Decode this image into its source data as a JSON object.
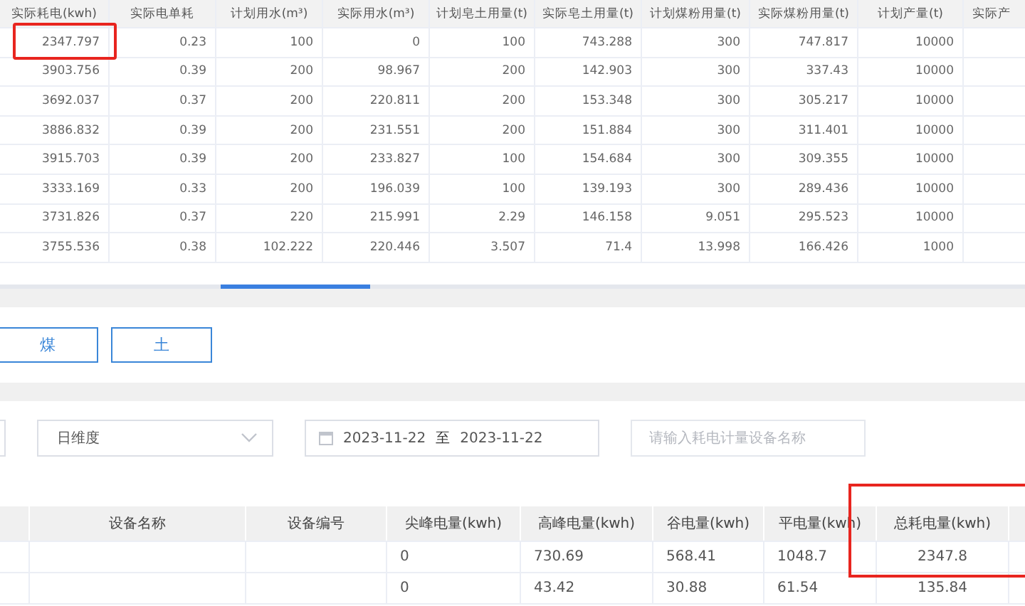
{
  "top_table": {
    "columns": [
      {
        "label": "实际耗电(kwh)"
      },
      {
        "label": "实际电单耗"
      },
      {
        "label": "计划用水(m³)"
      },
      {
        "label": "实际用水(m³)"
      },
      {
        "label": "计划皂土用量(t)"
      },
      {
        "label": "实际皂土用量(t)"
      },
      {
        "label": "计划煤粉用量(t)"
      },
      {
        "label": "实际煤粉用量(t)"
      },
      {
        "label": "计划产量(t)"
      },
      {
        "label": "实际产"
      }
    ],
    "rows": [
      [
        "2347.797",
        "0.23",
        "100",
        "0",
        "100",
        "743.288",
        "300",
        "747.817",
        "10000",
        ""
      ],
      [
        "3903.756",
        "0.39",
        "200",
        "98.967",
        "200",
        "142.903",
        "300",
        "337.43",
        "10000",
        ""
      ],
      [
        "3692.037",
        "0.37",
        "200",
        "220.811",
        "200",
        "153.348",
        "300",
        "305.217",
        "10000",
        ""
      ],
      [
        "3886.832",
        "0.39",
        "200",
        "231.551",
        "200",
        "151.884",
        "300",
        "311.401",
        "10000",
        ""
      ],
      [
        "3915.703",
        "0.39",
        "200",
        "233.827",
        "100",
        "154.684",
        "300",
        "309.355",
        "10000",
        ""
      ],
      [
        "3333.169",
        "0.33",
        "200",
        "196.039",
        "100",
        "139.193",
        "300",
        "289.436",
        "10000",
        ""
      ],
      [
        "3731.826",
        "0.37",
        "220",
        "215.991",
        "2.29",
        "146.158",
        "9.051",
        "295.523",
        "10000",
        ""
      ],
      [
        "3755.536",
        "0.38",
        "102.222",
        "220.446",
        "3.507",
        "71.4",
        "13.998",
        "166.426",
        "1000",
        ""
      ]
    ]
  },
  "category_buttons": [
    {
      "label": "煤"
    },
    {
      "label": "土"
    }
  ],
  "filters": {
    "dimension": "日维度",
    "date_from": "2023-11-22",
    "date_separator": "至",
    "date_to": "2023-11-22",
    "search": {
      "placeholder": "请输入耗电计量设备名称"
    }
  },
  "bottom_table": {
    "columns": [
      {},
      {
        "label": "设备名称"
      },
      {
        "label": "设备编号"
      },
      {
        "label": "尖峰电量(kwh)"
      },
      {
        "label": "高峰电量(kwh)"
      },
      {
        "label": "谷电量(kwh)"
      },
      {
        "label": "平电量(kwh)"
      },
      {
        "label": "总耗电量(kwh)"
      },
      {}
    ],
    "rows": [
      [
        "",
        "",
        "",
        "0",
        "730.69",
        "568.41",
        "1048.7",
        "2347.8",
        ""
      ],
      [
        "",
        "",
        "",
        "0",
        "43.42",
        "30.88",
        "61.54",
        "135.84",
        ""
      ]
    ]
  },
  "highlights": {
    "top_first_cell": true,
    "bottom_total_column": true
  }
}
